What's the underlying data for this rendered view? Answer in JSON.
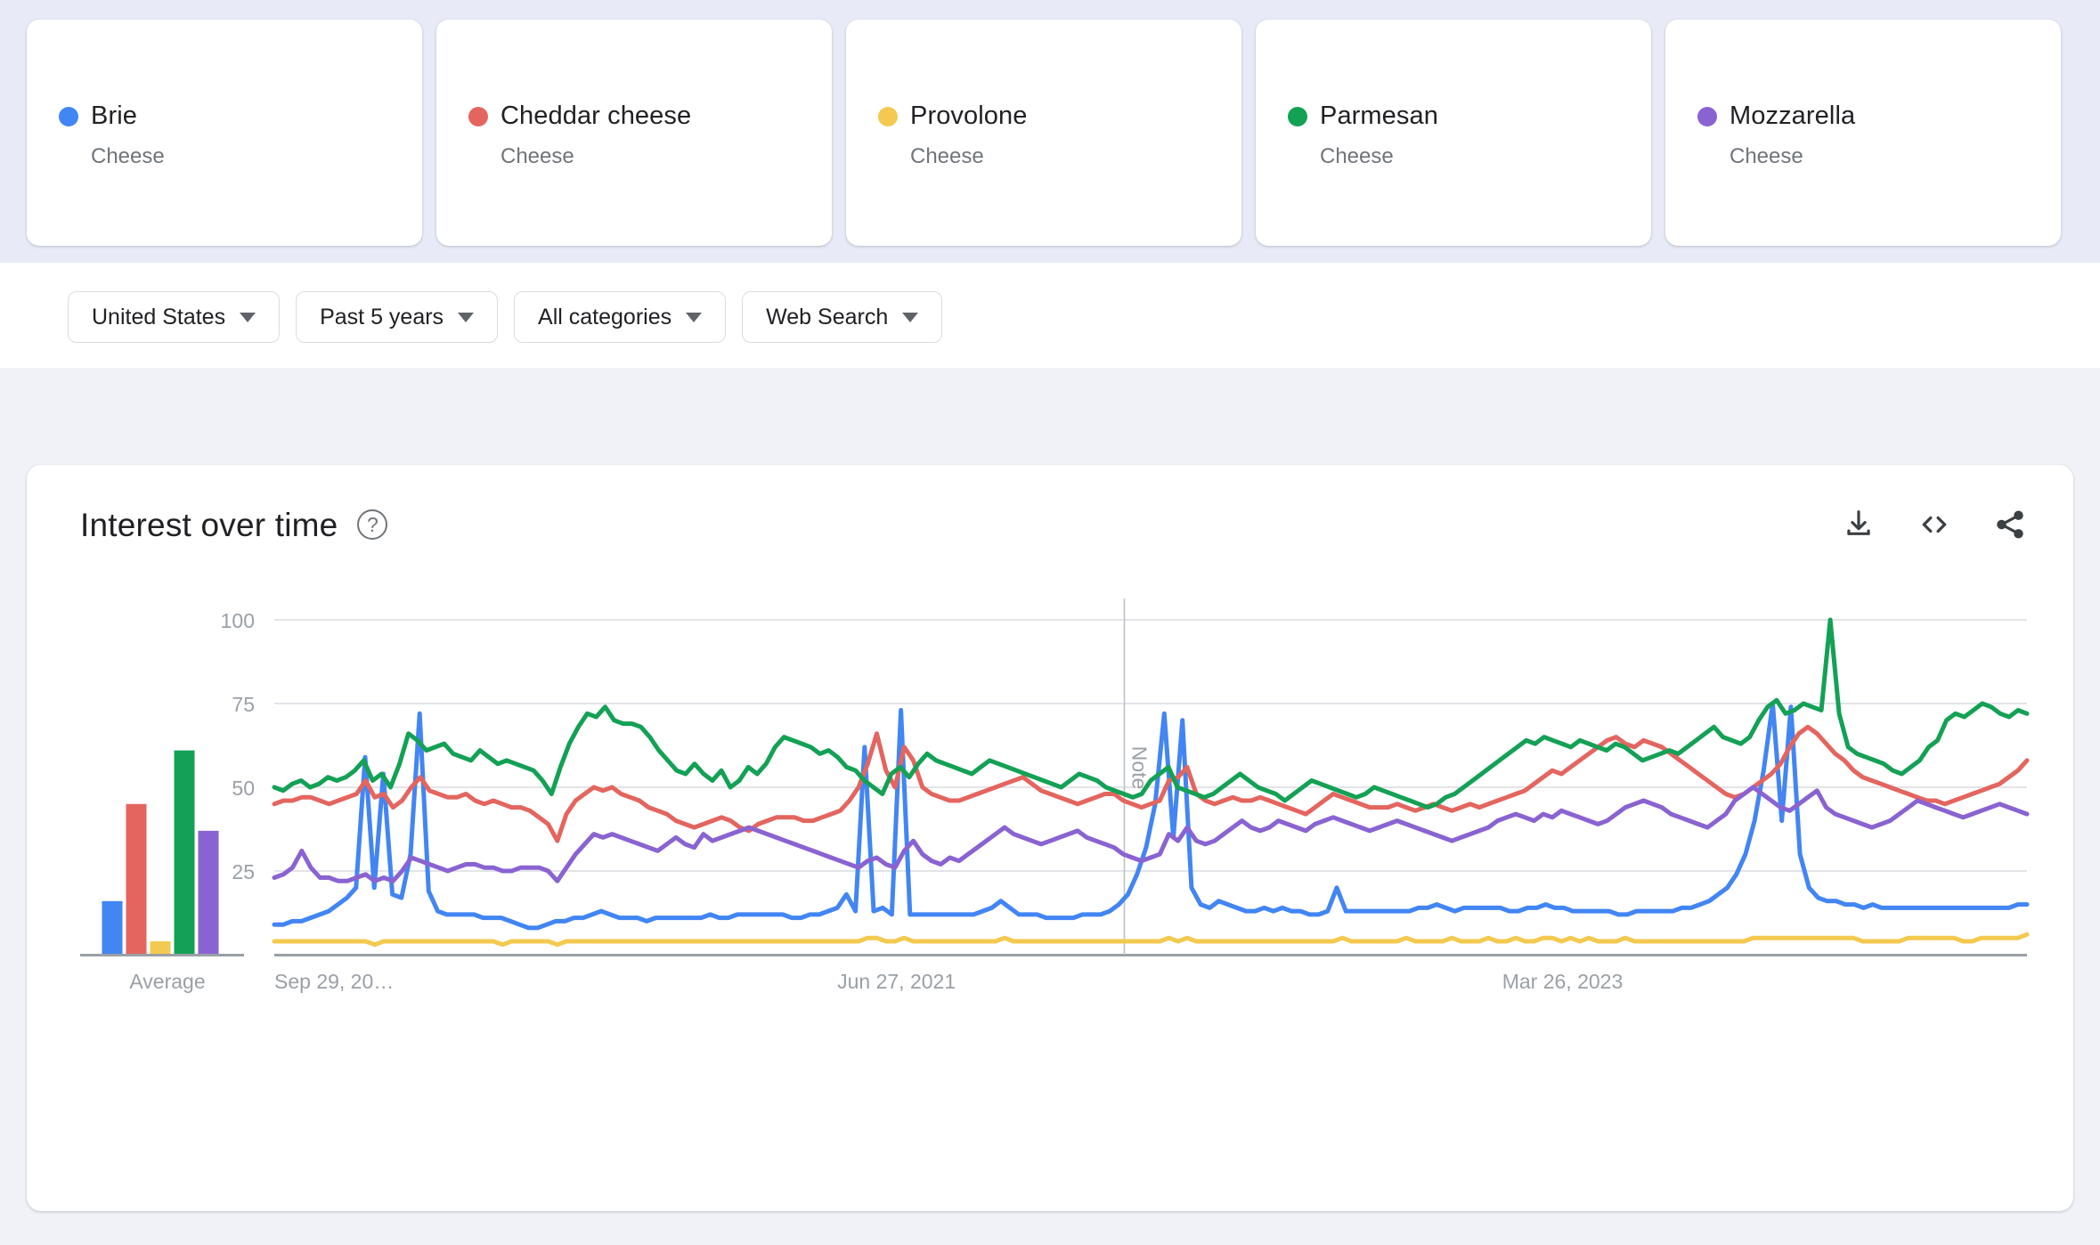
{
  "terms": [
    {
      "name": "Brie",
      "subtitle": "Cheese",
      "color": "#4285f4"
    },
    {
      "name": "Cheddar cheese",
      "subtitle": "Cheese",
      "color": "#e4655f"
    },
    {
      "name": "Provolone",
      "subtitle": "Cheese",
      "color": "#f3c94f"
    },
    {
      "name": "Parmesan",
      "subtitle": "Cheese",
      "color": "#13a155"
    },
    {
      "name": "Mozzarella",
      "subtitle": "Cheese",
      "color": "#8a63d2"
    }
  ],
  "filters": [
    {
      "label": "United States"
    },
    {
      "label": "Past 5 years"
    },
    {
      "label": "All categories"
    },
    {
      "label": "Web Search"
    }
  ],
  "card": {
    "title": "Interest over time",
    "help_icon": "help-circle-icon",
    "actions": [
      {
        "icon": "download-icon"
      },
      {
        "icon": "embed-code-icon"
      },
      {
        "icon": "share-icon"
      }
    ]
  },
  "chart_data": {
    "type": "line",
    "title": "Interest over time",
    "xlabel": "",
    "ylabel": "",
    "ylim": [
      0,
      100
    ],
    "yticks": [
      100,
      75,
      50,
      25
    ],
    "xtick_labels": [
      "Sep 29, 20…",
      "Jun 27, 2021",
      "Mar 26, 2023"
    ],
    "xtick_positions": [
      0,
      0.355,
      0.735
    ],
    "grid": true,
    "legend_position": "cards-above",
    "annotations": [
      {
        "label": "Note",
        "x": 0.485,
        "orientation": "vertical"
      }
    ],
    "average_bar": {
      "type": "bar",
      "label": "Average",
      "categories": [
        "Brie",
        "Cheddar cheese",
        "Provolone",
        "Parmesan",
        "Mozzarella"
      ],
      "values": [
        16,
        45,
        4,
        61,
        37
      ],
      "colors": [
        "#4285f4",
        "#e4655f",
        "#f3c94f",
        "#13a155",
        "#8a63d2"
      ]
    },
    "series": [
      {
        "name": "Brie",
        "color": "#4285f4",
        "values": [
          9,
          9,
          10,
          10,
          11,
          12,
          13,
          15,
          17,
          20,
          59,
          20,
          54,
          18,
          17,
          30,
          72,
          19,
          13,
          12,
          12,
          12,
          12,
          11,
          11,
          11,
          10,
          9,
          8,
          8,
          9,
          10,
          10,
          11,
          11,
          12,
          13,
          12,
          11,
          11,
          11,
          10,
          11,
          11,
          11,
          11,
          11,
          11,
          12,
          11,
          11,
          12,
          12,
          12,
          12,
          12,
          12,
          11,
          11,
          12,
          12,
          13,
          14,
          18,
          13,
          62,
          13,
          14,
          12,
          73,
          12,
          12,
          12,
          12,
          12,
          12,
          12,
          12,
          13,
          14,
          16,
          14,
          12,
          12,
          12,
          11,
          11,
          11,
          11,
          12,
          12,
          12,
          13,
          15,
          18,
          24,
          32,
          45,
          72,
          35,
          70,
          20,
          15,
          14,
          16,
          15,
          14,
          13,
          13,
          14,
          13,
          14,
          13,
          13,
          12,
          12,
          13,
          20,
          13,
          13,
          13,
          13,
          13,
          13,
          13,
          13,
          14,
          14,
          15,
          14,
          13,
          14,
          14,
          14,
          14,
          14,
          13,
          13,
          14,
          14,
          15,
          14,
          14,
          13,
          13,
          13,
          13,
          13,
          12,
          12,
          13,
          13,
          13,
          13,
          13,
          14,
          14,
          15,
          16,
          18,
          20,
          24,
          30,
          40,
          55,
          75,
          40,
          74,
          30,
          20,
          17,
          16,
          16,
          15,
          15,
          14,
          15,
          14,
          14,
          14,
          14,
          14,
          14,
          14,
          14,
          14,
          14,
          14,
          14,
          14,
          14,
          14,
          15,
          15
        ]
      },
      {
        "name": "Cheddar cheese",
        "color": "#e4655f",
        "values": [
          45,
          46,
          46,
          47,
          47,
          46,
          45,
          46,
          47,
          48,
          52,
          47,
          48,
          44,
          46,
          50,
          53,
          49,
          48,
          47,
          47,
          48,
          46,
          45,
          46,
          45,
          44,
          44,
          43,
          41,
          39,
          34,
          42,
          46,
          48,
          50,
          49,
          50,
          48,
          47,
          46,
          44,
          43,
          42,
          40,
          39,
          38,
          39,
          40,
          41,
          40,
          38,
          37,
          39,
          40,
          41,
          41,
          41,
          40,
          40,
          41,
          42,
          43,
          46,
          50,
          57,
          66,
          55,
          50,
          62,
          58,
          50,
          48,
          47,
          46,
          46,
          47,
          48,
          49,
          50,
          51,
          52,
          53,
          51,
          49,
          48,
          47,
          46,
          45,
          46,
          47,
          48,
          48,
          46,
          45,
          44,
          45,
          46,
          52,
          53,
          56,
          48,
          46,
          45,
          46,
          47,
          46,
          46,
          47,
          46,
          45,
          44,
          43,
          42,
          44,
          46,
          48,
          47,
          46,
          45,
          44,
          44,
          44,
          45,
          44,
          43,
          44,
          45,
          44,
          43,
          44,
          45,
          44,
          45,
          46,
          47,
          48,
          49,
          51,
          53,
          55,
          54,
          56,
          58,
          60,
          62,
          64,
          65,
          63,
          62,
          64,
          63,
          62,
          60,
          58,
          56,
          54,
          52,
          50,
          48,
          47,
          48,
          50,
          52,
          54,
          57,
          62,
          66,
          68,
          66,
          63,
          60,
          58,
          55,
          53,
          52,
          51,
          50,
          49,
          48,
          47,
          46,
          46,
          45,
          46,
          47,
          48,
          49,
          50,
          51,
          53,
          55,
          58
        ]
      },
      {
        "name": "Provolone",
        "color": "#f3c94f",
        "values": [
          4,
          4,
          4,
          4,
          4,
          4,
          4,
          4,
          4,
          4,
          4,
          3,
          4,
          4,
          4,
          4,
          4,
          4,
          4,
          4,
          4,
          4,
          4,
          4,
          4,
          3,
          4,
          4,
          4,
          4,
          4,
          3,
          4,
          4,
          4,
          4,
          4,
          4,
          4,
          4,
          4,
          4,
          4,
          4,
          4,
          4,
          4,
          4,
          4,
          4,
          4,
          4,
          4,
          4,
          4,
          4,
          4,
          4,
          4,
          4,
          4,
          4,
          4,
          4,
          4,
          5,
          5,
          4,
          4,
          5,
          4,
          4,
          4,
          4,
          4,
          4,
          4,
          4,
          4,
          4,
          5,
          4,
          4,
          4,
          4,
          4,
          4,
          4,
          4,
          4,
          4,
          4,
          4,
          4,
          4,
          4,
          4,
          4,
          5,
          4,
          5,
          4,
          4,
          4,
          4,
          4,
          4,
          4,
          4,
          4,
          4,
          4,
          4,
          4,
          4,
          4,
          4,
          5,
          4,
          4,
          4,
          4,
          4,
          4,
          5,
          4,
          4,
          4,
          4,
          5,
          4,
          4,
          4,
          5,
          4,
          4,
          5,
          4,
          4,
          5,
          5,
          4,
          5,
          4,
          5,
          4,
          4,
          4,
          5,
          4,
          4,
          4,
          4,
          4,
          4,
          4,
          4,
          4,
          4,
          4,
          4,
          4,
          5,
          5,
          5,
          5,
          5,
          5,
          5,
          5,
          5,
          5,
          5,
          5,
          4,
          4,
          4,
          4,
          4,
          5,
          5,
          5,
          5,
          5,
          5,
          4,
          4,
          5,
          5,
          5,
          5,
          5,
          6
        ]
      },
      {
        "name": "Parmesan",
        "color": "#13a155",
        "values": [
          50,
          49,
          51,
          52,
          50,
          51,
          53,
          52,
          53,
          55,
          58,
          52,
          54,
          50,
          57,
          66,
          64,
          61,
          62,
          63,
          60,
          59,
          58,
          61,
          59,
          57,
          58,
          57,
          56,
          55,
          52,
          48,
          56,
          63,
          68,
          72,
          71,
          74,
          70,
          69,
          69,
          68,
          65,
          61,
          58,
          55,
          54,
          57,
          54,
          52,
          55,
          50,
          52,
          56,
          54,
          57,
          62,
          65,
          64,
          63,
          62,
          60,
          61,
          59,
          56,
          55,
          52,
          50,
          48,
          54,
          56,
          53,
          57,
          60,
          58,
          57,
          56,
          55,
          54,
          56,
          58,
          57,
          56,
          55,
          54,
          53,
          52,
          51,
          50,
          52,
          54,
          53,
          52,
          50,
          49,
          48,
          47,
          48,
          52,
          54,
          56,
          50,
          49,
          48,
          47,
          48,
          50,
          52,
          54,
          52,
          50,
          49,
          48,
          46,
          48,
          50,
          52,
          51,
          50,
          49,
          48,
          47,
          48,
          50,
          49,
          48,
          47,
          46,
          45,
          44,
          45,
          47,
          48,
          50,
          52,
          54,
          56,
          58,
          60,
          62,
          64,
          63,
          65,
          64,
          63,
          62,
          64,
          63,
          62,
          61,
          63,
          62,
          60,
          58,
          59,
          60,
          61,
          60,
          62,
          64,
          66,
          68,
          65,
          64,
          63,
          65,
          70,
          74,
          76,
          72,
          73,
          75,
          74,
          73,
          100,
          72,
          62,
          60,
          59,
          58,
          57,
          55,
          54,
          56,
          58,
          62,
          64,
          70,
          72,
          71,
          73,
          75,
          74,
          72,
          71,
          73,
          72
        ]
      },
      {
        "name": "Mozzarella",
        "color": "#8a63d2",
        "values": [
          23,
          24,
          26,
          31,
          26,
          23,
          23,
          22,
          22,
          23,
          24,
          22,
          23,
          22,
          25,
          29,
          28,
          27,
          26,
          25,
          26,
          27,
          27,
          26,
          26,
          25,
          25,
          26,
          26,
          26,
          25,
          22,
          26,
          30,
          33,
          36,
          35,
          36,
          35,
          34,
          33,
          32,
          31,
          33,
          35,
          33,
          32,
          36,
          34,
          35,
          36,
          37,
          38,
          37,
          36,
          35,
          34,
          33,
          32,
          31,
          30,
          29,
          28,
          27,
          26,
          28,
          29,
          27,
          26,
          31,
          34,
          30,
          28,
          27,
          29,
          28,
          30,
          32,
          34,
          36,
          38,
          36,
          35,
          34,
          33,
          34,
          35,
          36,
          37,
          35,
          34,
          33,
          32,
          30,
          29,
          28,
          29,
          30,
          36,
          34,
          38,
          34,
          33,
          34,
          36,
          38,
          40,
          38,
          37,
          38,
          40,
          39,
          38,
          37,
          39,
          40,
          41,
          40,
          39,
          38,
          37,
          38,
          39,
          40,
          39,
          38,
          37,
          36,
          35,
          34,
          35,
          36,
          37,
          38,
          40,
          41,
          42,
          41,
          40,
          42,
          41,
          43,
          42,
          41,
          40,
          39,
          40,
          42,
          44,
          45,
          46,
          45,
          44,
          42,
          41,
          40,
          39,
          38,
          40,
          42,
          46,
          48,
          50,
          48,
          46,
          44,
          43,
          45,
          47,
          49,
          44,
          42,
          41,
          40,
          39,
          38,
          39,
          40,
          42,
          44,
          46,
          45,
          44,
          43,
          42,
          41,
          42,
          43,
          44,
          45,
          44,
          43,
          42
        ]
      }
    ]
  }
}
